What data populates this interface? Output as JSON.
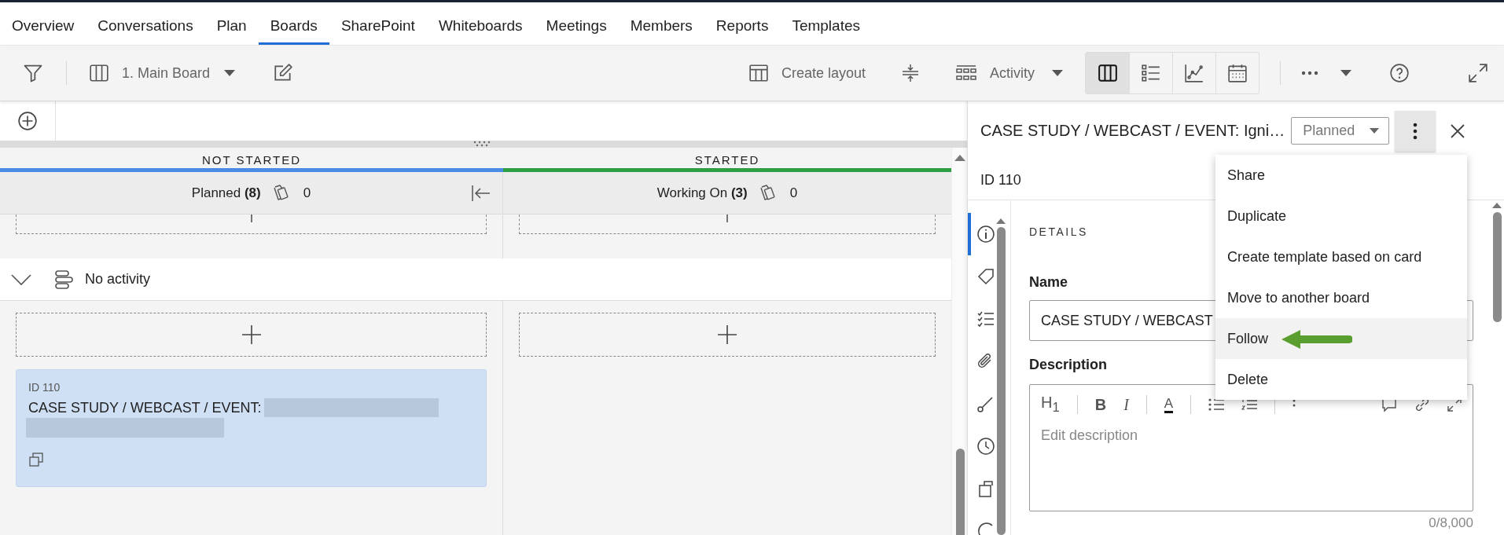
{
  "nav_tabs": [
    {
      "label": "Overview",
      "selected": false
    },
    {
      "label": "Conversations",
      "selected": false
    },
    {
      "label": "Plan",
      "selected": false
    },
    {
      "label": "Boards",
      "selected": true
    },
    {
      "label": "SharePoint",
      "selected": false
    },
    {
      "label": "Whiteboards",
      "selected": false
    },
    {
      "label": "Meetings",
      "selected": false
    },
    {
      "label": "Members",
      "selected": false
    },
    {
      "label": "Reports",
      "selected": false
    },
    {
      "label": "Templates",
      "selected": false
    }
  ],
  "toolbar": {
    "board": "1. Main Board",
    "create_layout": "Create layout",
    "group_by": "Activity",
    "views": [
      {
        "kind": "board",
        "selected": true
      },
      {
        "kind": "list",
        "selected": false
      },
      {
        "kind": "chart",
        "selected": false
      },
      {
        "kind": "calendar",
        "selected": false
      }
    ]
  },
  "columns": [
    {
      "stage": "NOT STARTED",
      "color": "#4a8be3",
      "title": "Planned **(8)**",
      "card_count": "0",
      "collapse_button": true,
      "cards": [
        {
          "id": "ID 110",
          "title": "CASE STUDY / WEBCAST / EVENT:"
        }
      ]
    },
    {
      "stage": "STARTED",
      "color": "#2ea043",
      "title": "Working On **(3)**",
      "card_count": "0",
      "collapse_button": false
    }
  ],
  "swimlane": {
    "label": "No activity",
    "expanded": true
  },
  "panel": {
    "title": "CASE STUDY / WEBCAST / EVENT: Igni…",
    "status": "Planned",
    "menu_open": true,
    "id": "ID 110",
    "rail": [
      {
        "kind": "info",
        "selected": true
      },
      {
        "kind": "tag",
        "selected": false
      },
      {
        "kind": "checklist",
        "selected": false
      },
      {
        "kind": "attachment",
        "selected": false
      },
      {
        "kind": "connector",
        "selected": false
      },
      {
        "kind": "clock",
        "selected": false
      },
      {
        "kind": "box",
        "selected": false
      },
      {
        "kind": "arc",
        "selected": false
      }
    ],
    "section": "DETAILS",
    "name_label": "Name",
    "name_value": "CASE STUDY / WEBCAST",
    "description_label": "Description",
    "editor_tools": [
      {
        "kind": "heading",
        "label": "H$_{1}$"
      },
      {
        "kind": "bold",
        "label": "B"
      },
      {
        "kind": "italic",
        "label": "I"
      },
      {
        "kind": "text_color",
        "label": "A"
      },
      {
        "kind": "bullet_list"
      },
      {
        "kind": "numbered_list"
      },
      {
        "kind": "more"
      },
      {
        "kind": "comment"
      },
      {
        "kind": "link"
      },
      {
        "kind": "expand"
      }
    ],
    "description_placeholder": "Edit description",
    "char_count": "0/8,000",
    "menu": [
      {
        "label": "Share",
        "selected": false
      },
      {
        "label": "Duplicate",
        "selected": false
      },
      {
        "label": "Create template based on card",
        "selected": false
      },
      {
        "label": "Move to another board",
        "selected": false
      },
      {
        "label": "Follow",
        "selected": true,
        "annotation_arrow": true
      },
      {
        "label": "Delete",
        "selected": false
      }
    ]
  }
}
